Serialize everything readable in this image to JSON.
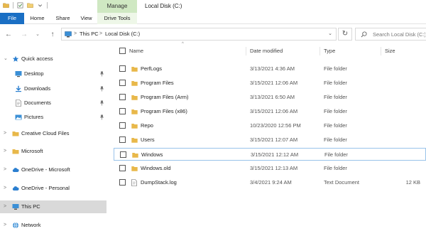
{
  "window": {
    "title": "Local Disk (C:)",
    "manage_context": "Manage",
    "accent": "#1a6fc4",
    "context_color": "#cfe8c2"
  },
  "ribbon": {
    "tabs": [
      {
        "label": "File"
      },
      {
        "label": "Home"
      },
      {
        "label": "Share"
      },
      {
        "label": "View"
      },
      {
        "label": "Drive Tools"
      }
    ]
  },
  "address": {
    "crumbs": [
      "This PC",
      "Local Disk (C:)"
    ],
    "separator": ">",
    "dropdown_glyph": "⌄",
    "refresh_glyph": "↻",
    "back_glyph": "←",
    "forward_glyph": "→",
    "history_glyph": "⌄",
    "up_glyph": "↑"
  },
  "search": {
    "placeholder": "Search Local Disk (C:)"
  },
  "nav": {
    "items": [
      {
        "label": "Quick access",
        "icon": "star-icon",
        "expander": "⌄",
        "pinned": false
      },
      {
        "label": "Desktop",
        "icon": "desktop-icon",
        "expander": "",
        "pinned": true
      },
      {
        "label": "Downloads",
        "icon": "download-icon",
        "expander": "",
        "pinned": true
      },
      {
        "label": "Documents",
        "icon": "documents-icon",
        "expander": "",
        "pinned": true
      },
      {
        "label": "Pictures",
        "icon": "pictures-icon",
        "expander": "",
        "pinned": true
      },
      {
        "label": "Creative Cloud Files",
        "icon": "folder-icon",
        "expander": ">",
        "pinned": false
      },
      {
        "label": "Microsoft",
        "icon": "folder-icon",
        "expander": ">",
        "pinned": false
      },
      {
        "label": "OneDrive - Microsoft",
        "icon": "cloud-icon",
        "expander": ">",
        "pinned": false
      },
      {
        "label": "OneDrive - Personal",
        "icon": "cloud-icon",
        "expander": ">",
        "pinned": false
      },
      {
        "label": "This PC",
        "icon": "pc-icon",
        "expander": ">",
        "pinned": false,
        "selected": true
      },
      {
        "label": "Network",
        "icon": "network-icon",
        "expander": ">",
        "pinned": false
      }
    ]
  },
  "files": {
    "columns": {
      "name": "Name",
      "date": "Date modified",
      "type": "Type",
      "size": "Size"
    },
    "sort_glyph": "^",
    "rows": [
      {
        "name": "PerfLogs",
        "date": "3/13/2021 4:36 AM",
        "type": "File folder",
        "size": "",
        "kind": "folder"
      },
      {
        "name": "Program Files",
        "date": "3/15/2021 12:06 AM",
        "type": "File folder",
        "size": "",
        "kind": "folder"
      },
      {
        "name": "Program Files (Arm)",
        "date": "3/13/2021 6:50 AM",
        "type": "File folder",
        "size": "",
        "kind": "folder"
      },
      {
        "name": "Program Files (x86)",
        "date": "3/15/2021 12:06 AM",
        "type": "File folder",
        "size": "",
        "kind": "folder"
      },
      {
        "name": "Repo",
        "date": "10/23/2020 12:56 PM",
        "type": "File folder",
        "size": "",
        "kind": "folder"
      },
      {
        "name": "Users",
        "date": "3/15/2021 12:07 AM",
        "type": "File folder",
        "size": "",
        "kind": "folder"
      },
      {
        "name": "Windows",
        "date": "3/15/2021 12:12 AM",
        "type": "File folder",
        "size": "",
        "kind": "folder",
        "focused": true
      },
      {
        "name": "Windows.old",
        "date": "3/15/2021 12:13 AM",
        "type": "File folder",
        "size": "",
        "kind": "folder"
      },
      {
        "name": "DumpStack.log",
        "date": "3/4/2021 9:24 AM",
        "type": "Text Document",
        "size": "12 KB",
        "kind": "file"
      }
    ],
    "folder_color": "#e8b84a"
  }
}
